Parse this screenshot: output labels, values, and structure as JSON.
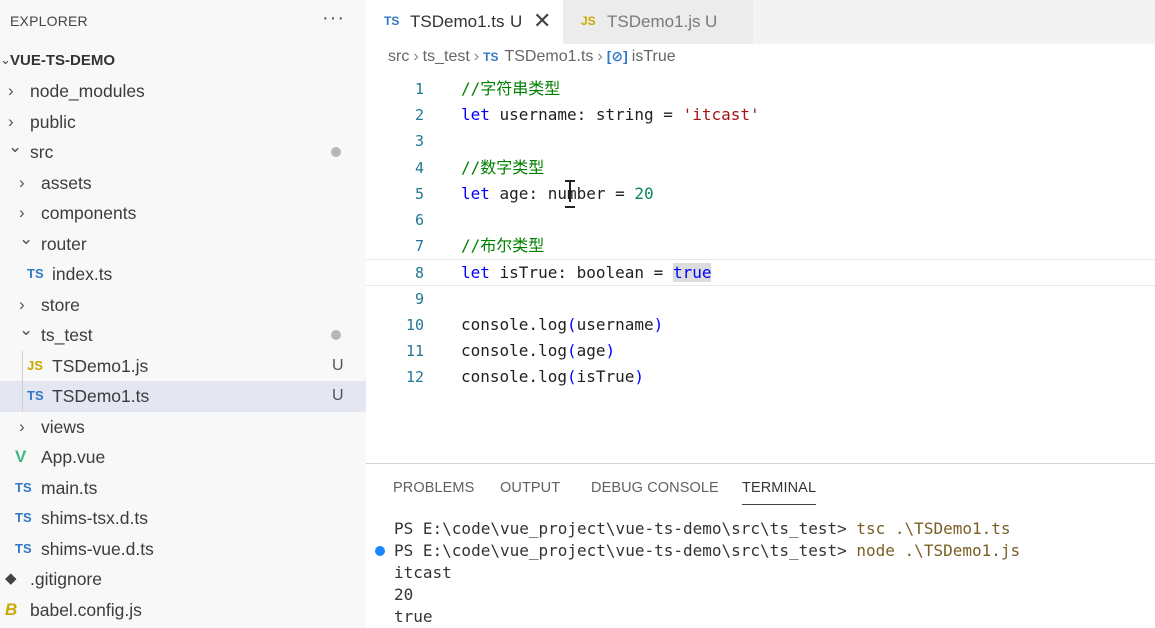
{
  "explorer": {
    "title": "EXPLORER",
    "more": "···",
    "root": "VUE-TS-DEMO",
    "items": [
      {
        "name": "node_modules",
        "kind": "folder",
        "expanded": false
      },
      {
        "name": "public",
        "kind": "folder",
        "expanded": false
      },
      {
        "name": "src",
        "kind": "folder",
        "expanded": true,
        "dot": true
      },
      {
        "name": "assets",
        "kind": "folder",
        "expanded": false
      },
      {
        "name": "components",
        "kind": "folder",
        "expanded": false
      },
      {
        "name": "router",
        "kind": "folder",
        "expanded": true
      },
      {
        "name": "index.ts",
        "kind": "ts",
        "icon": "TS"
      },
      {
        "name": "store",
        "kind": "folder",
        "expanded": false
      },
      {
        "name": "ts_test",
        "kind": "folder",
        "expanded": true,
        "dot": true
      },
      {
        "name": "TSDemo1.js",
        "kind": "js",
        "icon": "JS",
        "badge": "U"
      },
      {
        "name": "TSDemo1.ts",
        "kind": "ts",
        "icon": "TS",
        "badge": "U",
        "selected": true
      },
      {
        "name": "views",
        "kind": "folder",
        "expanded": false
      },
      {
        "name": "App.vue",
        "kind": "vue"
      },
      {
        "name": "main.ts",
        "kind": "ts",
        "icon": "TS"
      },
      {
        "name": "shims-tsx.d.ts",
        "kind": "ts",
        "icon": "TS"
      },
      {
        "name": "shims-vue.d.ts",
        "kind": "ts",
        "icon": "TS"
      },
      {
        "name": ".gitignore",
        "kind": "git"
      },
      {
        "name": "babel.config.js",
        "kind": "babel"
      }
    ]
  },
  "tabs": [
    {
      "icon": "TS",
      "label": "TSDemo1.ts",
      "status": "U",
      "close": "✕"
    },
    {
      "icon": "JS",
      "label": "TSDemo1.js",
      "status": "U"
    }
  ],
  "breadcrumb": {
    "parts": [
      "src",
      "ts_test"
    ],
    "file_icon": "TS",
    "file": "TSDemo1.ts",
    "symbol_icon": "[⊘]",
    "symbol": "isTrue"
  },
  "code": {
    "lines": [
      [
        {
          "t": "//字符串类型",
          "c": "cm"
        }
      ],
      [
        {
          "t": "let",
          "c": "kw"
        },
        {
          "t": " username: string = "
        },
        {
          "t": "'itcast'",
          "c": "str"
        }
      ],
      [],
      [
        {
          "t": "//数字类型",
          "c": "cm"
        }
      ],
      [
        {
          "t": "let",
          "c": "kw"
        },
        {
          "t": " age: number = "
        },
        {
          "t": "20",
          "c": "num"
        }
      ],
      [],
      [
        {
          "t": "//布尔类型",
          "c": "cm"
        }
      ],
      [
        {
          "t": "let",
          "c": "kw"
        },
        {
          "t": " isTrue: boolean = "
        },
        {
          "t": "true",
          "c": "kw hl"
        }
      ],
      [],
      [
        {
          "t": "console.log"
        },
        {
          "t": "(",
          "c": "kw"
        },
        {
          "t": "username"
        },
        {
          "t": ")",
          "c": "kw"
        }
      ],
      [
        {
          "t": "console.log"
        },
        {
          "t": "(",
          "c": "kw"
        },
        {
          "t": "age"
        },
        {
          "t": ")",
          "c": "kw"
        }
      ],
      [
        {
          "t": "console.log"
        },
        {
          "t": "(",
          "c": "kw"
        },
        {
          "t": "isTrue"
        },
        {
          "t": ")",
          "c": "kw"
        }
      ]
    ],
    "current_line": 8
  },
  "panel": {
    "tabs": [
      "PROBLEMS",
      "OUTPUT",
      "DEBUG CONSOLE",
      "TERMINAL"
    ],
    "active_tab": "TERMINAL",
    "terminal": [
      {
        "prompt": "PS E:\\code\\vue_project\\vue-ts-demo\\src\\ts_test>",
        "cmd": " tsc .\\TSDemo1.ts"
      },
      {
        "prompt": "PS E:\\code\\vue_project\\vue-ts-demo\\src\\ts_test>",
        "cmd": " node .\\TSDemo1.js",
        "marker": true
      },
      {
        "text": "itcast"
      },
      {
        "text": "20"
      },
      {
        "text": "true"
      }
    ]
  },
  "colors": {
    "ts": "#3178c6",
    "js": "#c9a800",
    "vue": "#41b883",
    "keyword": "#0000ff",
    "string": "#a31515",
    "comment": "#008000",
    "number": "#098658"
  }
}
